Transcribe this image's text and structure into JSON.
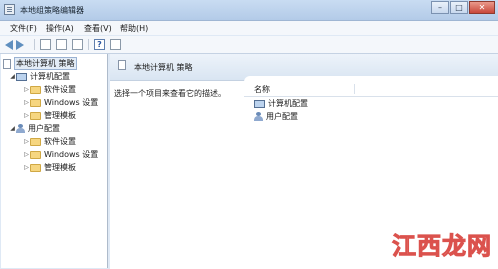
{
  "window": {
    "title": "本地组策略编辑器",
    "buttons": [
      "–",
      "□",
      "✕"
    ]
  },
  "menu": [
    "文件(F)",
    "操作(A)",
    "查看(V)",
    "帮助(H)"
  ],
  "tree": {
    "root": "本地计算机 策略",
    "computer": {
      "label": "计算机配置",
      "children": [
        "软件设置",
        "Windows 设置",
        "管理模板"
      ]
    },
    "user": {
      "label": "用户配置",
      "children": [
        "软件设置",
        "Windows 设置",
        "管理模板"
      ]
    }
  },
  "right": {
    "header": "本地计算机 策略",
    "description": "选择一个项目来查看它的描述。",
    "column_name": "名称",
    "items": [
      "计算机配置",
      "用户配置"
    ]
  },
  "watermark": "江西龙网"
}
